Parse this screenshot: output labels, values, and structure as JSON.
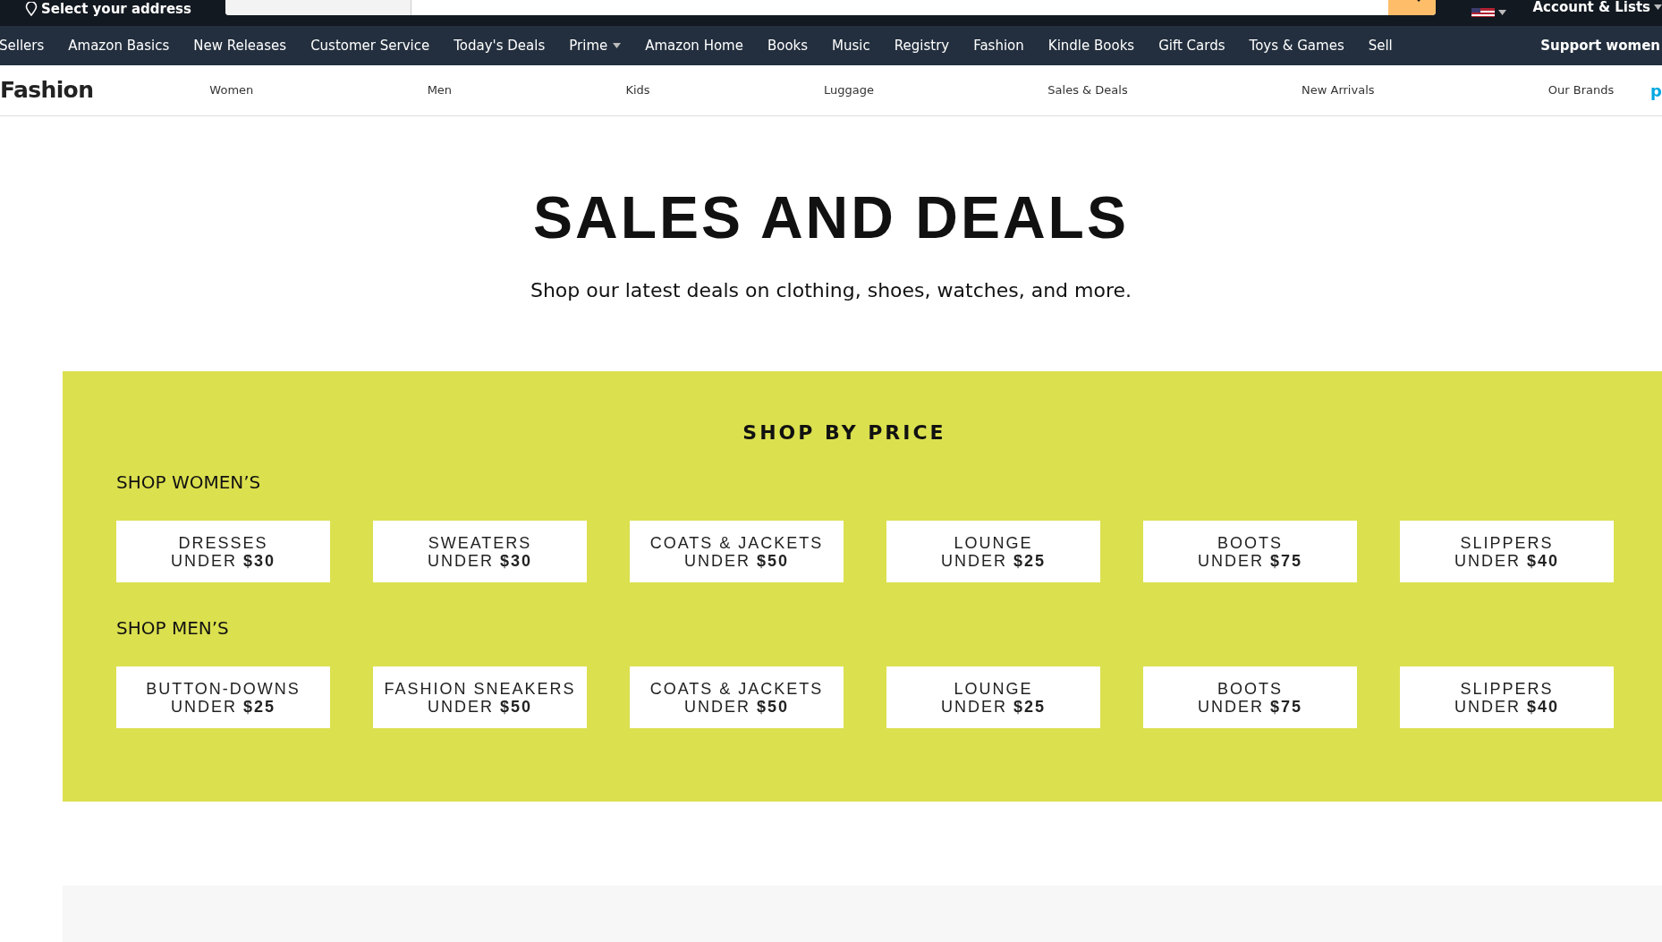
{
  "top_bar": {
    "address": "Select your address",
    "account": "Account & Lists"
  },
  "nav": [
    {
      "label": "Sellers",
      "dropdown": false
    },
    {
      "label": "Amazon Basics",
      "dropdown": false
    },
    {
      "label": "New Releases",
      "dropdown": false
    },
    {
      "label": "Customer Service",
      "dropdown": false
    },
    {
      "label": "Today's Deals",
      "dropdown": false
    },
    {
      "label": "Prime",
      "dropdown": true
    },
    {
      "label": "Amazon Home",
      "dropdown": false
    },
    {
      "label": "Books",
      "dropdown": false
    },
    {
      "label": "Music",
      "dropdown": false
    },
    {
      "label": "Registry",
      "dropdown": false
    },
    {
      "label": "Fashion",
      "dropdown": false
    },
    {
      "label": "Kindle Books",
      "dropdown": false
    },
    {
      "label": "Gift Cards",
      "dropdown": false
    },
    {
      "label": "Toys & Games",
      "dropdown": false
    },
    {
      "label": "Sell",
      "dropdown": false
    }
  ],
  "nav_promo": "Support women",
  "sub_nav": {
    "title": "Fashion",
    "items": [
      "Women",
      "Men",
      "Kids",
      "Luggage",
      "Sales & Deals",
      "New Arrivals",
      "Our Brands"
    ],
    "cut_item": "p"
  },
  "hero": {
    "title": "SALES AND DEALS",
    "subtitle": "Shop our latest deals on clothing, shoes, watches, and more."
  },
  "shop_by_price": {
    "title": "SHOP BY PRICE",
    "groups": [
      {
        "heading": "SHOP WOMEN’S",
        "tiles": [
          {
            "label": "DRESSES",
            "price": "UNDER **$30**"
          },
          {
            "label": "SWEATERS",
            "price": "UNDER **$30**"
          },
          {
            "label": "COATS & JACKETS",
            "price": "UNDER **$50**"
          },
          {
            "label": "LOUNGE",
            "price": "UNDER **$25**"
          },
          {
            "label": "BOOTS",
            "price": "UNDER **$75**"
          },
          {
            "label": "SLIPPERS",
            "price": "UNDER **$40**"
          }
        ]
      },
      {
        "heading": "SHOP MEN’S",
        "tiles": [
          {
            "label": "BUTTON-DOWNS",
            "price": "UNDER **$25**"
          },
          {
            "label": "FASHION SNEAKERS",
            "price": "UNDER **$50**"
          },
          {
            "label": "COATS & JACKETS",
            "price": "UNDER **$50**"
          },
          {
            "label": "LOUNGE",
            "price": "UNDER **$25**"
          },
          {
            "label": "BOOTS",
            "price": "UNDER **$75**"
          },
          {
            "label": "SLIPPERS",
            "price": "UNDER **$40**"
          }
        ]
      }
    ]
  }
}
